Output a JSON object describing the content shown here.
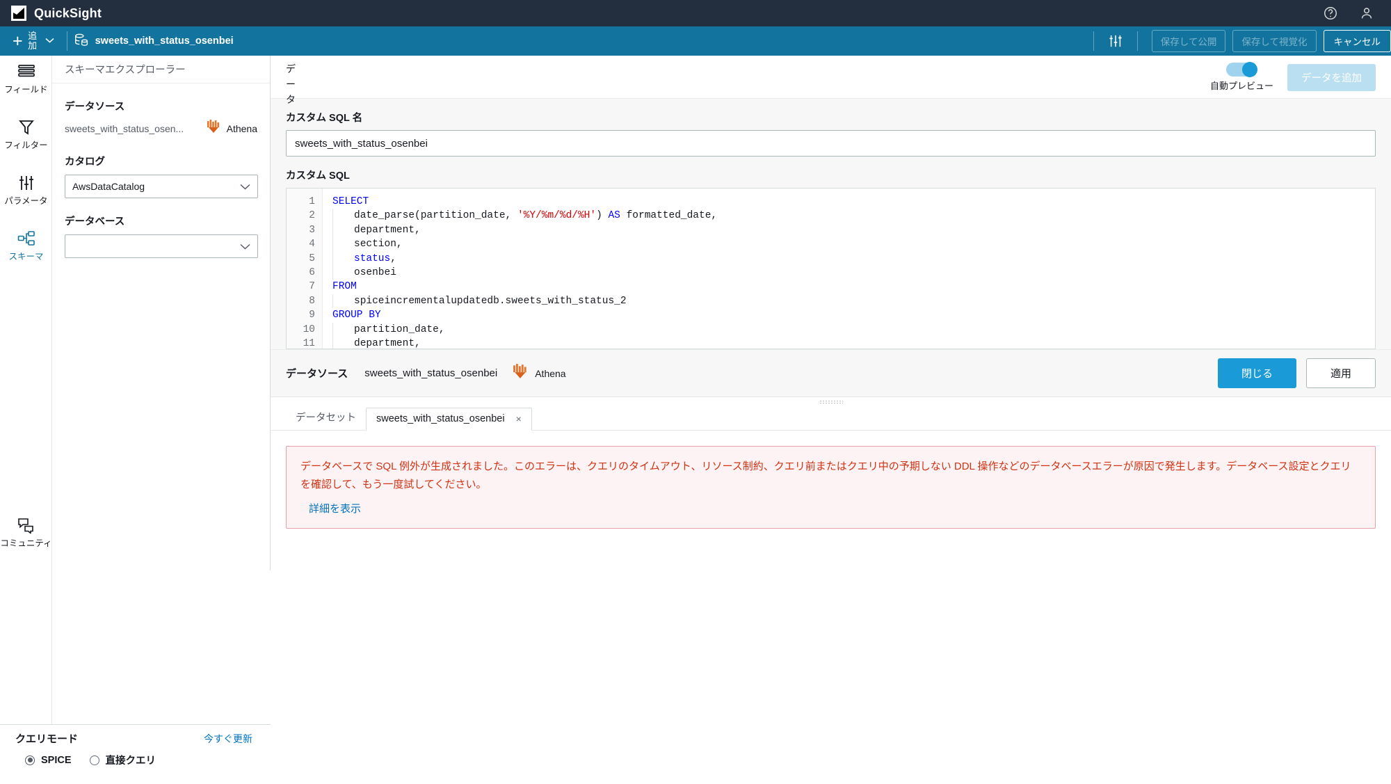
{
  "app": {
    "name": "QuickSight",
    "logo_icon": "quicksight-logo-icon",
    "help_icon": "help-circle-icon",
    "account_icon": "user-account-icon"
  },
  "actionbar": {
    "add_label_line1": "追",
    "add_label_line2": "加",
    "add_caret_icon": "chevron-down-icon",
    "dataset_icon": "database-icon",
    "dataset_name": "sweets_with_status_osenbei",
    "settings_icon": "sliders-icon",
    "save_publish_label": "保存して公開",
    "save_visualize_label": "保存して視覚化",
    "cancel_label": "キャンセル"
  },
  "rail": {
    "items": [
      {
        "label": "フィールド",
        "icon": "fields-icon",
        "active": false
      },
      {
        "label": "フィルター",
        "icon": "filter-funnel-icon",
        "active": false
      },
      {
        "label": "パラメータ",
        "icon": "parameters-sliders-icon",
        "active": false
      },
      {
        "label": "スキーマ",
        "icon": "schema-nodes-icon",
        "active": true
      },
      {
        "label": "コミュニティ",
        "icon": "community-chat-icon",
        "active": false
      }
    ]
  },
  "schema_panel": {
    "title": "スキーマエクスプローラー",
    "datasource_label": "データソース",
    "datasource_name": "sweets_with_status_osen...",
    "engine_name": "Athena",
    "engine_icon": "athena-icon",
    "catalog_label": "カタログ",
    "catalog_value": "AwsDataCatalog",
    "database_label": "データベース",
    "database_value": "",
    "caret_icon": "chevron-down-icon"
  },
  "query_mode": {
    "title": "クエリモード",
    "refresh_label": "今すぐ更新",
    "options": [
      {
        "label": "SPICE",
        "selected": true
      },
      {
        "label": "直接クエリ",
        "selected": false
      }
    ]
  },
  "main": {
    "data_tab_label": "データ",
    "auto_preview_label": "自動プレビュー",
    "auto_preview_on": true,
    "add_data_label": "データを追加",
    "custom_sql_name_label": "カスタム SQL 名",
    "custom_sql_name_value": "sweets_with_status_osenbei",
    "custom_sql_label": "カスタム SQL",
    "sql_lines": [
      {
        "n": "1",
        "indent": 0,
        "tokens": [
          {
            "t": "SELECT",
            "c": "kw"
          }
        ]
      },
      {
        "n": "2",
        "indent": 1,
        "tokens": [
          {
            "t": "date_parse(partition_date, ",
            "c": ""
          },
          {
            "t": "'%Y/%m/%d/%H'",
            "c": "str"
          },
          {
            "t": ") ",
            "c": ""
          },
          {
            "t": "AS",
            "c": "kw"
          },
          {
            "t": " formatted_date,",
            "c": ""
          }
        ]
      },
      {
        "n": "3",
        "indent": 1,
        "tokens": [
          {
            "t": "department,",
            "c": ""
          }
        ]
      },
      {
        "n": "4",
        "indent": 1,
        "tokens": [
          {
            "t": "section,",
            "c": ""
          }
        ]
      },
      {
        "n": "5",
        "indent": 1,
        "tokens": [
          {
            "t": "status",
            "c": "kw"
          },
          {
            "t": ",",
            "c": ""
          }
        ]
      },
      {
        "n": "6",
        "indent": 1,
        "tokens": [
          {
            "t": "osenbei",
            "c": ""
          }
        ]
      },
      {
        "n": "7",
        "indent": 0,
        "tokens": [
          {
            "t": "FROM",
            "c": "kw"
          }
        ]
      },
      {
        "n": "8",
        "indent": 1,
        "tokens": [
          {
            "t": "spiceincrementalupdatedb.sweets_with_status_2",
            "c": ""
          }
        ]
      },
      {
        "n": "9",
        "indent": 0,
        "tokens": [
          {
            "t": "GROUP BY",
            "c": "kw"
          }
        ]
      },
      {
        "n": "10",
        "indent": 1,
        "tokens": [
          {
            "t": "partition_date,",
            "c": ""
          }
        ]
      },
      {
        "n": "11",
        "indent": 1,
        "tokens": [
          {
            "t": "department,",
            "c": ""
          }
        ]
      }
    ],
    "footer": {
      "datasource_label": "データソース",
      "datasource_name": "sweets_with_status_osenbei",
      "engine_name": "Athena",
      "engine_icon": "athena-icon",
      "close_label": "閉じる",
      "apply_label": "適用"
    },
    "tabs": {
      "dataset_tab_label": "データセット",
      "active_tab_label": "sweets_with_status_osenbei",
      "close_icon": "close-icon"
    },
    "error": {
      "message": "データベースで SQL 例外が生成されました。このエラーは、クエリのタイムアウト、リソース制約、クエリ前またはクエリ中の予期しない DDL 操作などのデータベースエラーが原因で発生します。データベース設定とクエリを確認して、もう一度試してください。",
      "details_link": "詳細を表示"
    }
  },
  "colors": {
    "topbar": "#232f3e",
    "actionbar": "#12749e",
    "accent": "#1a9ad7",
    "link": "#0073bb",
    "error_text": "#d13212",
    "error_bg": "#fdf3f5",
    "athena_orange": "#e8762d"
  }
}
